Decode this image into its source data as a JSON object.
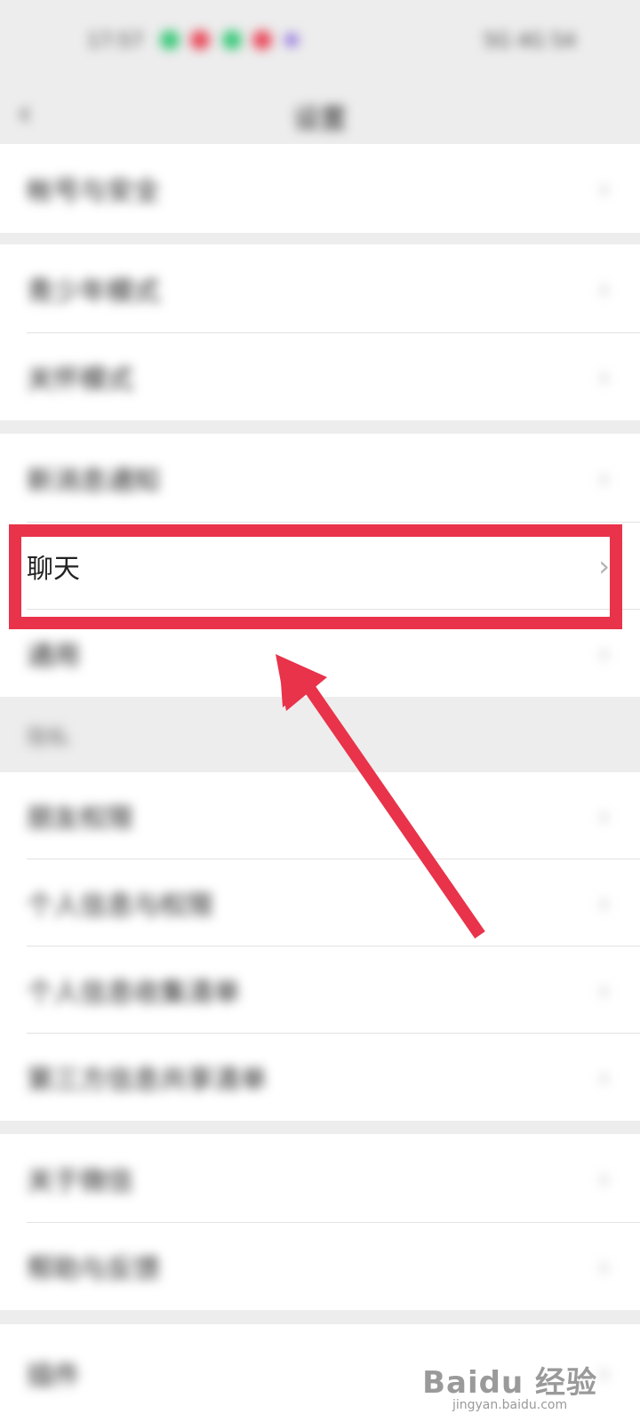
{
  "status_bar": {
    "time": "17:57",
    "right_text": "5G 4G 54",
    "icon_colors": [
      "#3cc87a",
      "#e94a5c",
      "#3cc87a",
      "#e94a5c",
      "#9a7fe0"
    ]
  },
  "nav": {
    "back_icon": "chevron-left-icon",
    "title": "设置"
  },
  "items": [
    {
      "label": "帐号与安全",
      "blurred": true
    },
    {
      "label": "青少年模式",
      "blurred": true
    },
    {
      "label": "关怀模式",
      "blurred": true
    },
    {
      "label": "新消息通知",
      "blurred": true
    },
    {
      "label": "聊天",
      "blurred": false
    },
    {
      "label": "通用",
      "blurred": true
    },
    {
      "group_label": "隐私",
      "blurred": true
    },
    {
      "label": "朋友权限",
      "blurred": true
    },
    {
      "label": "个人信息与权限",
      "blurred": true
    },
    {
      "label": "个人信息收集清单",
      "blurred": true
    },
    {
      "label": "第三方信息共享清单",
      "blurred": true
    },
    {
      "label": "关于微信",
      "blurred": true
    },
    {
      "label": "帮助与反馈",
      "blurred": true
    },
    {
      "label": "插件",
      "blurred": true
    }
  ],
  "chevron_char": "›",
  "annotation": {
    "highlight_color": "#e8334a"
  },
  "watermark": {
    "main": "Baidu 经验",
    "sub": "jingyan.baidu.com"
  }
}
